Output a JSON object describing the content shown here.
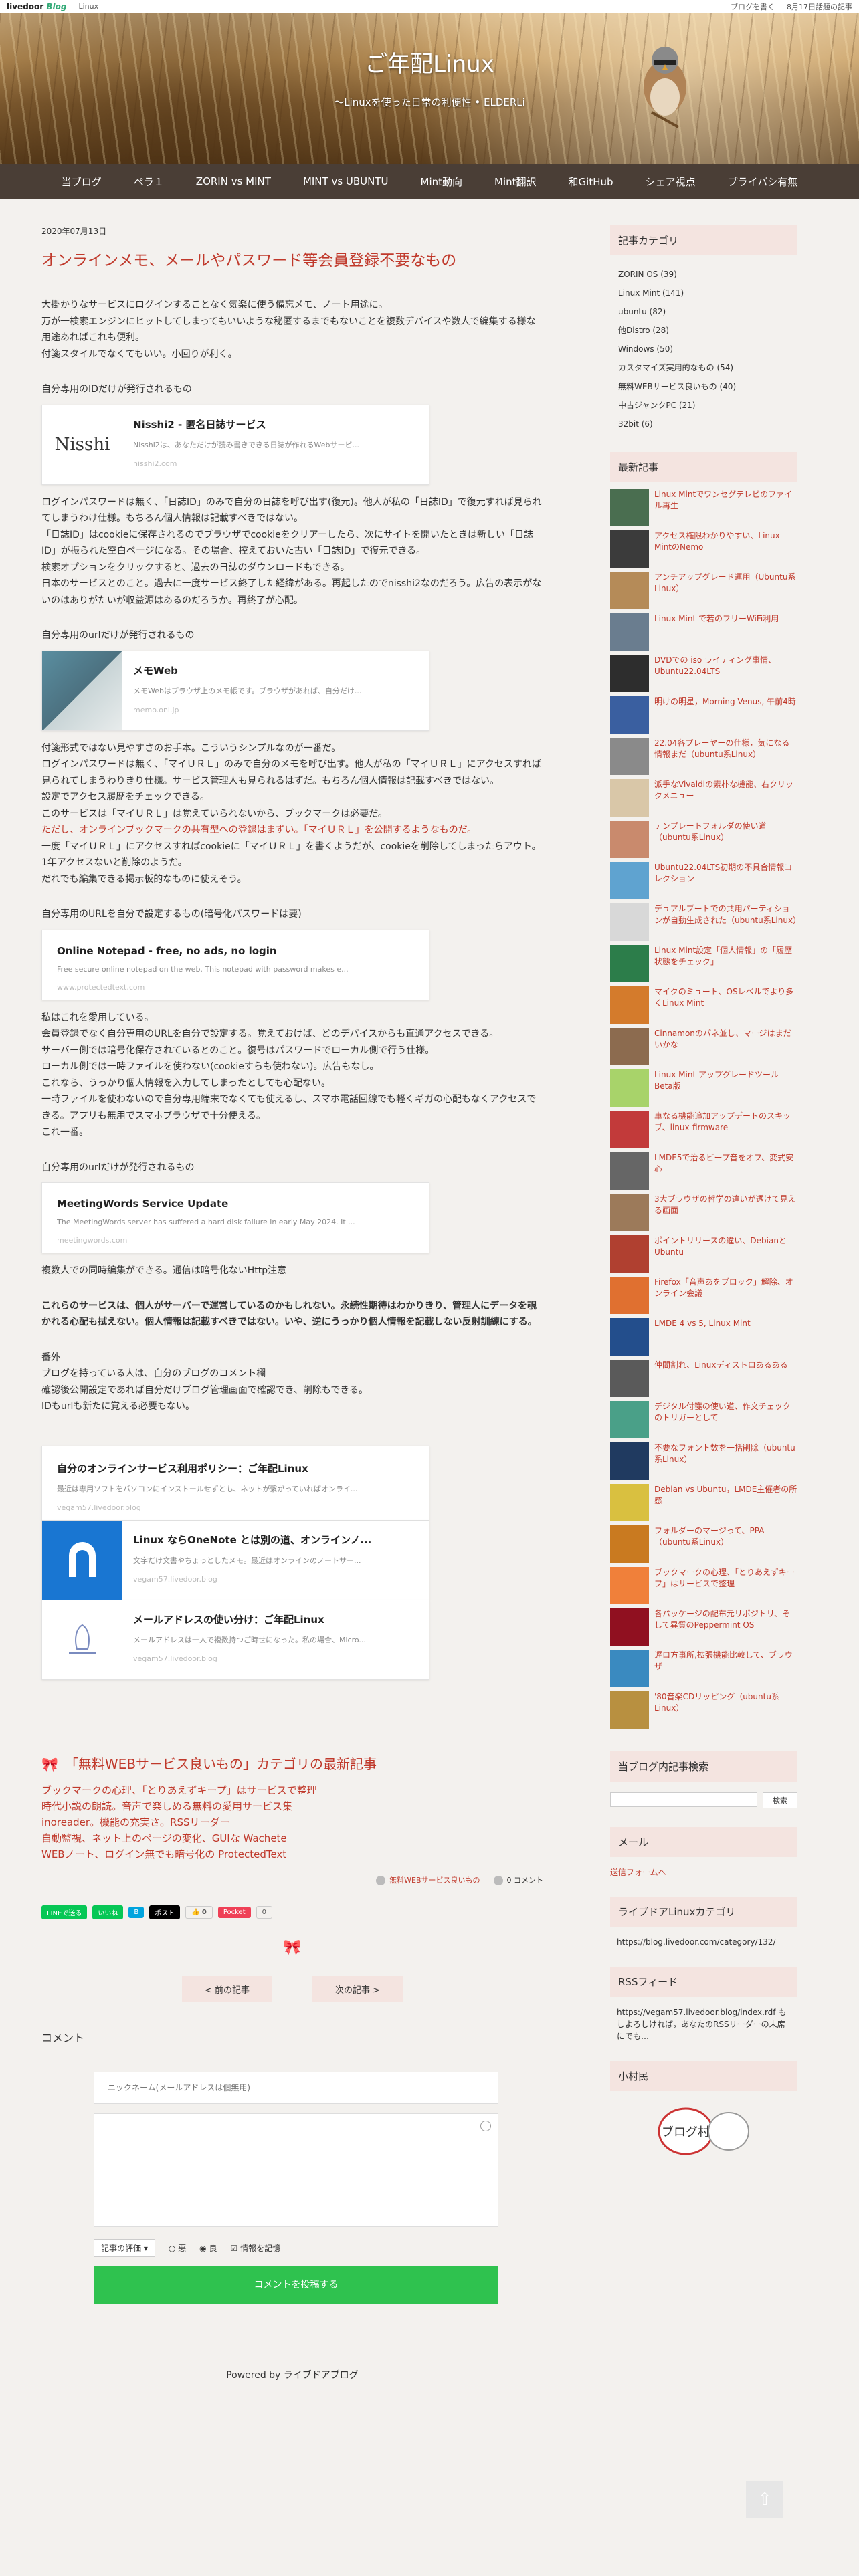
{
  "topbar": {
    "logo": "livedoor",
    "logo_blog": "Blog",
    "link": "Linux",
    "write": "ブログを書く",
    "date": "8月17日話題の記事"
  },
  "header": {
    "title": "ご年配Linux",
    "subtitle": "～Linuxを使った日常の利便性 • ELDERLi"
  },
  "nav": [
    "当ブログ",
    "ペラ１",
    "ZORIN vs MINT",
    "MINT vs UBUNTU",
    "Mint動向",
    "Mint翻訳",
    "和GitHub",
    "シェア視点",
    "プライバシ有無"
  ],
  "post": {
    "date": "2020年07月13日",
    "title": "オンラインメモ、メールやパスワード等会員登録不要なもの",
    "intro": [
      "大掛かりなサービスにログインすることなく気楽に使う備忘メモ、ノート用途に。",
      "万が一検索エンジンにヒットしてしまってもいいような秘匿するまでもないことを複数デバイスや数人で編集する様な用途あればこれも便利。",
      "付箋スタイルでなくてもいい。小回りが利く。"
    ],
    "s1_head": "自分専用のIDだけが発行されるもの",
    "card1": {
      "title": "Nisshi2 - 匿名日誌サービス",
      "desc": "Nisshi2は、あなただけが読み書きできる日誌が作れるWebサービ...",
      "url": "nisshi2.com",
      "thumb": "Nisshi"
    },
    "s1_body": [
      "ログインパスワードは無く、「日誌ID」のみで自分の日誌を呼び出す(復元)。他人が私の「日誌ID」で復元すれば見られてしまうわけ仕様。もちろん個人情報は記載すべきではない。",
      "「日誌ID」はcookieに保存されるのでブラウザでcookieをクリアーしたら、次にサイトを開いたときは新しい「日誌ID」が振られた空白ページになる。その場合、控えておいた古い「日誌ID」で復元できる。",
      "検索オプションをクリックすると、過去の日誌のダウンロードもできる。",
      "日本のサービスとのこと。過去に一度サービス終了した経緯がある。再起したのでnisshi2なのだろう。広告の表示がないのはありがたいが収益源はあるのだろうか。再終了が心配。"
    ],
    "s2_head": "自分専用のurlだけが発行されるもの",
    "card2": {
      "title": "メモWeb",
      "desc": "メモWebはブラウザ上のメモ帳です。ブラウザがあれば、自分だけ...",
      "url": "memo.onl.jp"
    },
    "s2_body": [
      "付箋形式ではない見やすさのお手本。こういうシンプルなのが一番だ。",
      "ログインパスワードは無く、「マイＵＲＬ」のみで自分のメモを呼び出す。他人が私の「マイＵＲＬ」にアクセスすれば見られてしまうわりきり仕様。サービス管理人も見られるはずだ。もちろん個人情報は記載すべきではない。",
      "設定でアクセス履歴をチェックできる。",
      "このサービスは「マイＵＲＬ」は覚えていられないから、ブックマークは必要だ。"
    ],
    "s2_red": "ただし、オンラインブックマークの共有型への登録はまずい。「マイＵＲＬ」を公開するようなものだ。",
    "s2_body2": [
      "一度「マイＵＲＬ」にアクセスすればcookieに「マイＵＲＬ」を書くようだが、cookieを削除してしまったらアウト。",
      "1年アクセスないと削除のようだ。",
      "だれでも編集できる掲示板的なものに使えそう。"
    ],
    "s3_head": "自分専用のURLを自分で設定するもの(暗号化パスワードは要)",
    "card3": {
      "title": "Online Notepad - free, no ads, no login",
      "desc": "Free secure online notepad on the web. This notepad with password makes e...",
      "url": "www.protectedtext.com"
    },
    "s3_body": [
      "私はこれを愛用している。",
      "会員登録でなく自分専用のURLを自分で設定する。覚えておけば、どのデバイスからも直通アクセスできる。",
      "サーバー側では暗号化保存されているとのこと。復号はパスワードでローカル側で行う仕様。",
      "ローカル側では一時ファイルを使わない(cookieすらも使わない)。広告もなし。",
      "これなら、うっかり個人情報を入力してしまったとしても心配ない。",
      "一時ファイルを使わないので自分専用端末でなくても使えるし、スマホ電話回線でも軽くギガの心配もなくアクセスできる。アプリも無用でスマホブラウザで十分使える。",
      "これ一番。"
    ],
    "s4_head": "自分専用のurlだけが発行されるもの",
    "card4": {
      "title": "MeetingWords Service Update",
      "desc": "The MeetingWords server has suffered a hard disk failure in early May 2024. It ...",
      "url": "meetingwords.com"
    },
    "s4_body": "複数人での同時編集ができる。通信は暗号化ないHttp注意",
    "bold_note": "これらのサービスは、個人がサーバーで運営しているのかもしれない。永続性期待はわかりきり、管理人にデータを覗かれる心配も拭えない。個人情報は記載すべきではない。いや、逆にうっかり個人情報を記載しない反射訓練にする。",
    "extra": [
      "番外",
      "ブログを持っている人は、自分のブログのコメント欄",
      "確認後公開設定であれば自分だけブログ管理画面で確認でき、削除もできる。",
      "IDもurlも新たに覚える必要もない。"
    ],
    "related": [
      {
        "title": "自分のオンラインサービス利用ポリシー：ご年配Linux",
        "desc": "最近は専用ソフトをパソコンにインストールせずとも、ネットが繋がっていればオンライ...",
        "url": "vegam57.livedoor.blog"
      },
      {
        "title": "Linux ならOneNote とは別の道、オンラインノ...",
        "desc": "文字だけ文書やちょっとしたメモ。最近はオンラインのノートサー...",
        "url": "vegam57.livedoor.blog"
      },
      {
        "title": "メールアドレスの使い分け：ご年配Linux",
        "desc": "メールアドレスは一人で複数持つご時世になった。私の場合、Micro...",
        "url": "vegam57.livedoor.blog"
      }
    ]
  },
  "cat_latest": {
    "head": "「無料WEBサービス良いもの」カテゴリの最新記事",
    "items": [
      "ブックマークの心理、「とりあえずキープ」はサービスで整理",
      "時代小説の朗読。音声で楽しめる無料の愛用サービス集",
      "inoreader。機能の充実さ。RSSリーダー",
      "自動監視、ネット上のページの変化、GUIな Wachete",
      "WEBノート、ログイン無でも暗号化の ProtectedText"
    ]
  },
  "meta": {
    "category": "無料WEBサービス良いもの",
    "comments": "0 コメント"
  },
  "share": {
    "line": "LINEで送る",
    "iine": "いいね",
    "hatena": "B",
    "x": "ポスト",
    "tweet": "0",
    "pocket": "Pocket",
    "pocket_count": "0",
    "share_count": "0"
  },
  "pager": {
    "prev": "< 前の記事",
    "next": "次の記事 >"
  },
  "comment": {
    "heading": "コメント",
    "name_placeholder": "ニックネーム(メールアドレスは個無用)",
    "rate": "記事の評価",
    "opt1": "悪",
    "opt2": "良",
    "remember": "情報を記憶",
    "submit": "コメントを投稿する"
  },
  "powered": "Powered by ライブドアブログ",
  "sidebar": {
    "cat_head": "記事カテゴリ",
    "categories": [
      "ZORIN OS (39)",
      "Linux Mint (141)",
      "ubuntu (82)",
      "他Distro (28)",
      "Windows (50)",
      "カスタマイズ実用的なもの (54)",
      "無料WEBサービス良いもの (40)",
      "中古ジャンクPC (21)",
      "32bit (6)"
    ],
    "recent_head": "最新記事",
    "recent": [
      "Linux Mintでワンセグテレビのファイル再生",
      "アクセス権限わかりやすい、Linux MintのNemo",
      "アンチアップグレード運用（Ubuntu系Linux）",
      "Linux Mint で若のフリーWiFi利用",
      "DVDでの iso ライティング事情、Ubuntu22.04LTS",
      "明けの明星，Morning Venus, 午前4時",
      "22.04各プレーヤーの仕様，気になる情報まだ（ubuntu系Linux）",
      "派手なVivaldiの素朴な機能、右クリックメニュー",
      "テンプレートフォルダの使い道（ubuntu系Linux）",
      "Ubuntu22.04LTS初期の不具合情報コレクション",
      "デュアルブートでの共用パーティションが自動生成された（ubuntu系Linux）",
      "Linux Mint設定「個人情報」の「履歴状態をチェック」",
      "マイクのミュート、OSレベルでより多くLinux Mint",
      "Cinnamonのパネ並し、マージはまだいかな",
      "Linux Mint アップグレードツール Beta版",
      "車なる機能追加アップデートのスキップ、linux-firmware",
      "LMDE5で治るビープ音をオフ、変式安心",
      "3大ブラウザの哲学の違いが透けて見える画面",
      "ポイントリリースの違い、Debianと Ubuntu",
      "Firefox「音声あをブロック」解除、オンライン会議",
      "LMDE 4 vs 5, Linux Mint",
      "仲間割れ、Linuxディストロあるある",
      "デジタル付箋の使い道、作文チェックのトリガーとして",
      "不要なフォント数を一括削除（ubuntu系Linux）",
      "Debian vs Ubuntu，LMDE主催者の所感",
      "フォルダーのマージって、PPA（ubuntu系Linux）",
      "ブックマークの心理、「とりあえずキープ」はサービスで整理",
      "各パッケージの配布元リポジトリ、そして異質のPeppermint OS",
      "遅ロ方事所,拡張機能比較して、ブラウザ",
      "'80音楽CDリッピング（ubuntu系Linux）"
    ],
    "search_head": "当ブログ内記事検索",
    "search_btn": "検索",
    "mail_head": "メール",
    "mail_link": "送信フォームへ",
    "lcat_head": "ライブドアLinuxカテゴリ",
    "lcat_url": "https://blog.livedoor.com/category/132/",
    "rss_head": "RSSフィード",
    "rss_text": "https://vegam57.livedoor.blog/index.rdf もしよろしければ，あなたのRSSリーダーの末席にでも…",
    "village_head": "小村民",
    "village_badge": "ブログ村"
  },
  "colors": {
    "accent": "#c0392b",
    "nav": "#4a3e36",
    "submit": "#2fc24f",
    "catbox": "#f4e4e0"
  }
}
